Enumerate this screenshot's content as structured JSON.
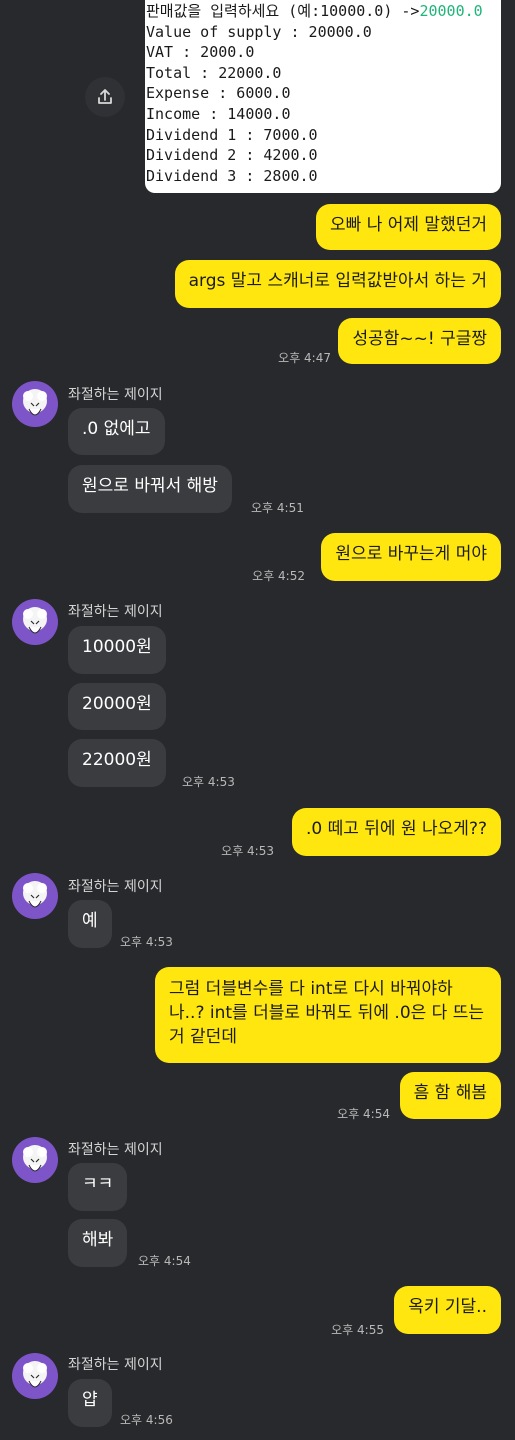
{
  "code_screenshot": {
    "lines": [
      {
        "text": "판매값을 입력하세요 (예:10000.0) ->",
        "input": "20000.0"
      },
      {
        "text": "Value of supply : 20000.0"
      },
      {
        "text": "VAT : 2000.0"
      },
      {
        "text": "Total : 22000.0"
      },
      {
        "text": "Expense : 6000.0"
      },
      {
        "text": "Income : 14000.0"
      },
      {
        "text": "Dividend 1 : 7000.0"
      },
      {
        "text": "Dividend 2 : 4200.0"
      },
      {
        "text": "Dividend 3 : 2800.0"
      }
    ]
  },
  "share_icon": "share-icon",
  "contact_name": "좌절하는 제이지",
  "messages": {
    "m1": "오빠 나 어제 말했던거",
    "m2": "args 말고 스캐너로 입력값받아서 하는 거",
    "m3": "성공함~~! 구글짱",
    "t3": "오후 4:47",
    "r1": ".0 없에고",
    "r2": "원으로 바꿔서 해방",
    "t_r2": "오후 4:51",
    "m4": "원으로 바꾸는게 머야",
    "t4": "오후 4:52",
    "r3": "10000원",
    "r4": "20000원",
    "r5": "22000원",
    "t_r5": "오후 4:53",
    "m5": ".0 떼고 뒤에 원 나오게??",
    "t5": "오후 4:53",
    "r6": "예",
    "t_r6": "오후 4:53",
    "m6": "그럼 더블변수를 다 int로 다시 바꿔야하나..? int를 더블로 바꿔도 뒤에 .0은 다 뜨는 거 같던데",
    "m7": "흠 함 해봄",
    "t7": "오후 4:54",
    "r7": "ㅋㅋ",
    "r8": "해봐",
    "t_r8": "오후 4:54",
    "m8": "옥키 기달..",
    "t8": "오후 4:55",
    "r9": "얍",
    "t_r9": "오후 4:56"
  },
  "colors": {
    "background": "#28292c",
    "my_bubble": "#ffe60f",
    "their_bubble": "#3b3c3f",
    "avatar_bg": "#7e55c9",
    "console_input": "#1fb57a"
  }
}
